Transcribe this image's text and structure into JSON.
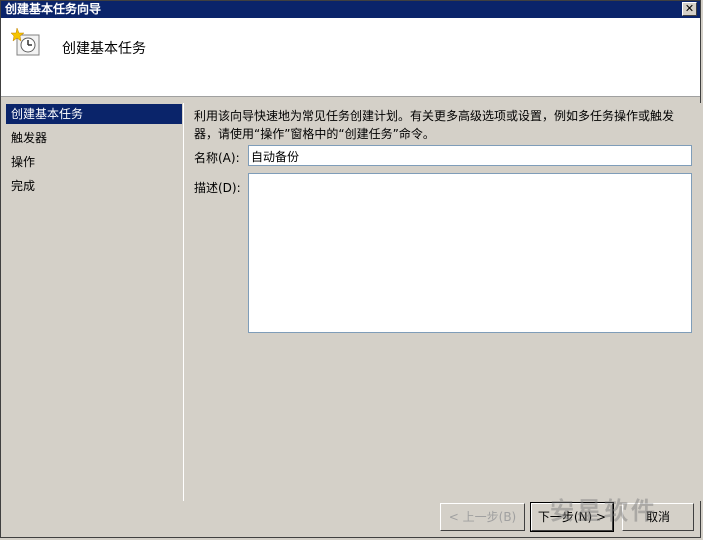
{
  "window": {
    "title": "创建基本任务向导"
  },
  "header": {
    "title": "创建基本任务",
    "icon": "task-clock-icon"
  },
  "nav": {
    "items": [
      {
        "label": "创建基本任务",
        "active": true
      },
      {
        "label": "触发器",
        "active": false
      },
      {
        "label": "操作",
        "active": false
      },
      {
        "label": "完成",
        "active": false
      }
    ]
  },
  "content": {
    "intro": "利用该向导快速地为常见任务创建计划。有关更多高级选项或设置，例如多任务操作或触发器，请使用“操作”窗格中的“创建任务”命令。",
    "name_label": "名称(A):",
    "name_value": "自动备份",
    "desc_label": "描述(D):",
    "desc_value": ""
  },
  "buttons": {
    "back": "< 上一步(B)",
    "next": "下一步(N) >",
    "cancel": "取消"
  },
  "watermark": "安星软件"
}
